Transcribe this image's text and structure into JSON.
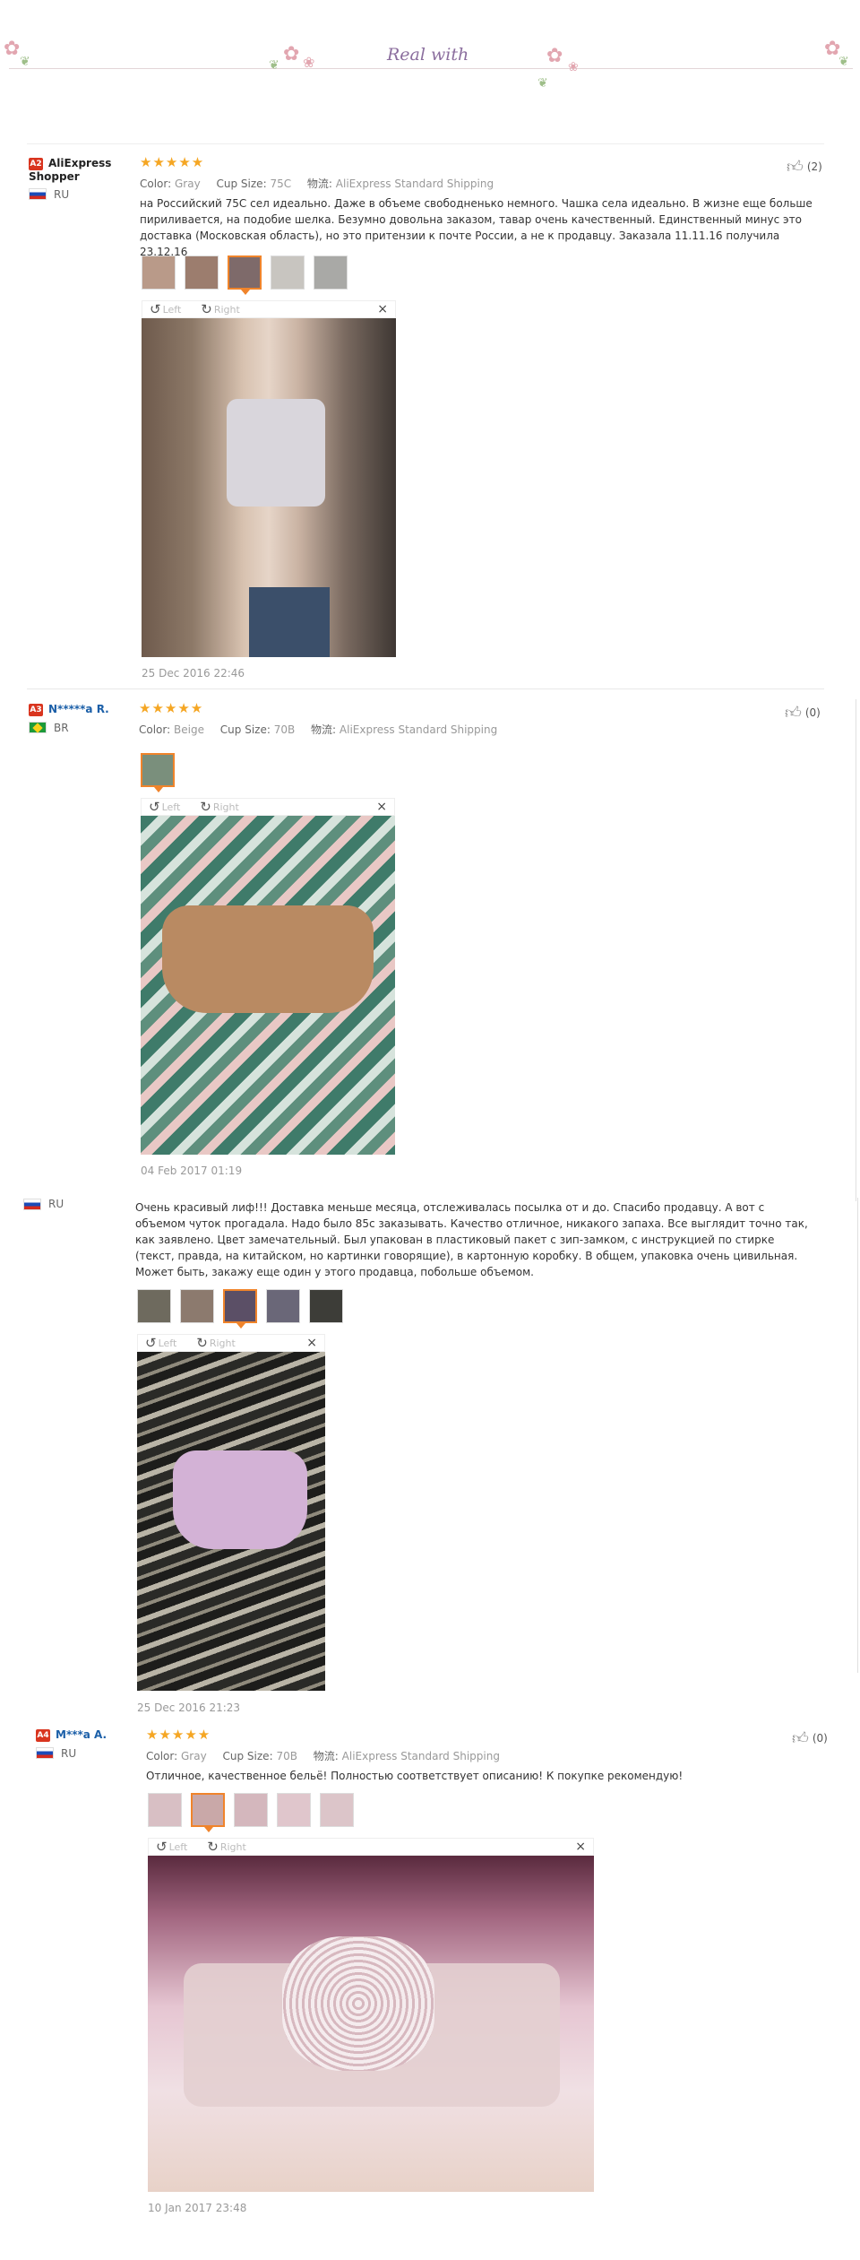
{
  "banner": {
    "logo_text": "Real with"
  },
  "reviews": [
    {
      "level": "A2",
      "name": "AliExpress Shopper",
      "country": "RU",
      "stars": "★★★★★",
      "color_label": "Color:",
      "color": "Gray",
      "cup_label": "Cup Size:",
      "cup": "75C",
      "ship_label": "物流:",
      "ship": "AliExpress Standard Shipping",
      "likes": "(2)",
      "text": "на Российский 75С сел идеально. Даже в объеме свободненько немного. Чашка села идеально. В жизне еще больше пириливается, на подобие шелка. Безумно довольна заказом, тавар очень качественный. Единственный минус это доставка (Московская область), но это притензии к почте России, а не к продавцу. Заказала 11.11.16 получила 23.12.16",
      "date": "25 Dec 2016 22:46"
    },
    {
      "level": "A3",
      "name": "N*****a R.",
      "country": "BR",
      "stars": "★★★★★",
      "color_label": "Color:",
      "color": "Beige",
      "cup_label": "Cup Size:",
      "cup": "70B",
      "ship_label": "物流:",
      "ship": "AliExpress Standard Shipping",
      "likes": "(0)",
      "date": "04 Feb 2017 01:19"
    },
    {
      "country": "RU",
      "text": "Очень красивый лиф!!! Доставка меньше месяца, отслеживалась посылка от и до. Спасибо продавцу. А вот с объемом чуток прогадала. Надо было 85с заказывать. Качество отличное, никакого запаха. Все выглядит точно так, как заявлено. Цвет замечательный. Был упакован в пластиковый пакет с зип-замком, с инструкцией по стирке (текст, правда, на китайском, но картинки говорящие), в картонную коробку. В общем, упаковка очень цивильная. Может быть, закажу еще один у этого продавца, побольше объемом.",
      "date": "25 Dec 2016 21:23"
    },
    {
      "level": "A4",
      "name": "M***a A.",
      "country": "RU",
      "stars": "★★★★★",
      "color_label": "Color:",
      "color": "Gray",
      "cup_label": "Cup Size:",
      "cup": "70B",
      "ship_label": "物流:",
      "ship": "AliExpress Standard Shipping",
      "likes": "(0)",
      "text": "Отличное, качественное бельё! Полностью соответствует описанию! К покупке рекомендую!",
      "date": "10 Jan 2017 23:48"
    }
  ],
  "viewer": {
    "left_label": "Left",
    "right_label": "Right",
    "close": "×"
  },
  "icons": {
    "like": "thumbs-up-icon",
    "rotate_left": "rotate-left-icon",
    "rotate_right": "rotate-right-icon",
    "close": "close-icon"
  },
  "colors": {
    "star": "#f5a623",
    "link": "#1b5fa8",
    "level_badge": "#d9351f",
    "selected_thumb": "#f0842b"
  }
}
